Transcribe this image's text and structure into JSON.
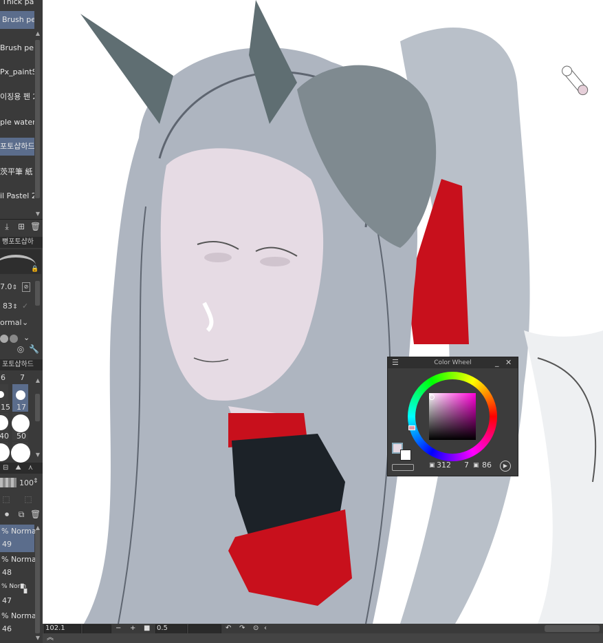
{
  "sub_tools": [
    {
      "label": "Thick paint",
      "selected": false
    },
    {
      "label": "Brush pen",
      "selected": true
    },
    {
      "label": "Brush pen",
      "selected": false
    },
    {
      "label": "Px_paintS",
      "selected": false
    },
    {
      "label": "이징용 펜 2",
      "selected": false
    },
    {
      "label": "ple water",
      "selected": false
    },
    {
      "label": "포토샵하드",
      "selected": true
    },
    {
      "label": "茨平筆 紙",
      "selected": false
    },
    {
      "label": "il Pastel 2",
      "selected": false
    }
  ],
  "tool_property": {
    "header": "뼝포토샵하",
    "brush_size": "7.0",
    "opacity": "83",
    "blend_mode": "ormal"
  },
  "brush_size_palette": {
    "header": "포토샵하드",
    "top_values": [
      "6",
      "7"
    ],
    "sizes": [
      "15",
      "17",
      "40",
      "50"
    ],
    "selected": "17"
  },
  "layer_panel": {
    "opacity": "100",
    "layers": [
      {
        "mode": "% Normal",
        "name": "49",
        "selected": true
      },
      {
        "mode": "% Normal",
        "name": "48",
        "selected": false
      },
      {
        "mode": "% Norm",
        "name": "47",
        "selected": false
      },
      {
        "mode": "% Normal",
        "name": "46",
        "selected": false
      }
    ]
  },
  "color_wheel": {
    "title": "Color Wheel",
    "hue": "312",
    "saturation": "7",
    "value": "86",
    "main_color": "#e6d8e2",
    "sub_color": "#ffffff"
  },
  "status_bar": {
    "zoom": "102.1",
    "rotation": "0.5"
  },
  "colors": {
    "panel_bg": "#3a3a3a",
    "selection": "#5b6d8c",
    "hair": "#9aa2ad",
    "outfit_red": "#c8101c",
    "skin": "#e8dce6"
  }
}
